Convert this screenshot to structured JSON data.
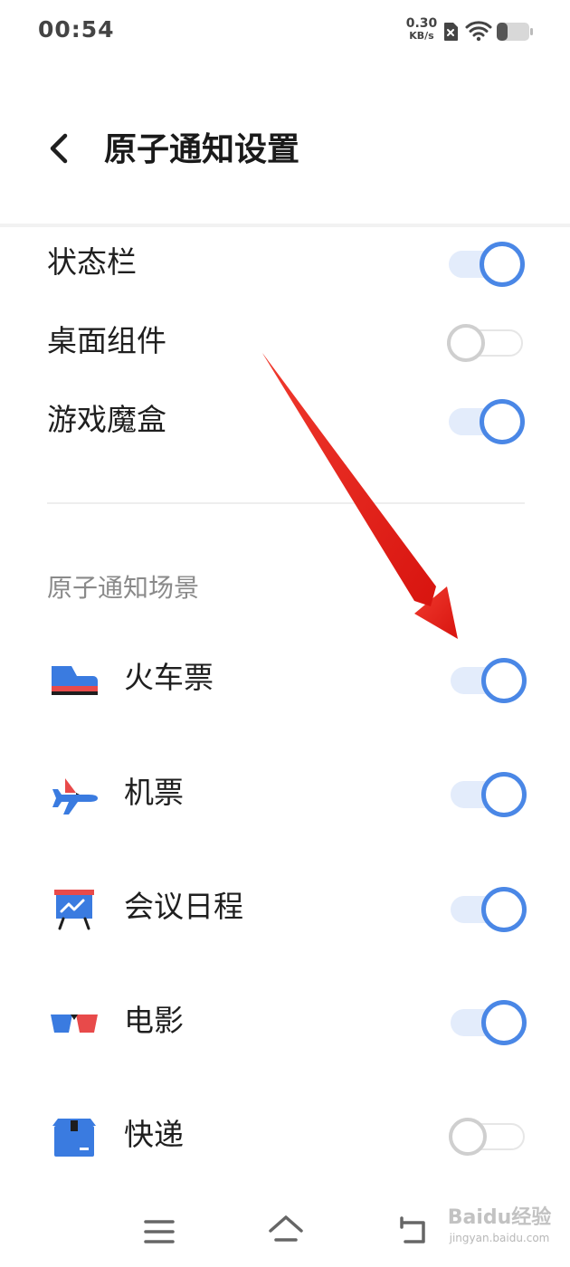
{
  "status_bar": {
    "time": "00:54",
    "net_speed_value": "0.30",
    "net_speed_unit": "KB/s",
    "icons": [
      "sim-disabled-icon",
      "wifi-icon",
      "battery-icon"
    ]
  },
  "header": {
    "back_icon": "chevron-left-icon",
    "title": "原子通知设置"
  },
  "display_locations": [
    {
      "label": "状态栏",
      "enabled": true
    },
    {
      "label": "桌面组件",
      "enabled": false
    },
    {
      "label": "游戏魔盒",
      "enabled": true
    }
  ],
  "scenes_section": {
    "title": "原子通知场景",
    "items": [
      {
        "label": "火车票",
        "icon": "train-icon",
        "enabled": true
      },
      {
        "label": "机票",
        "icon": "airplane-icon",
        "enabled": true
      },
      {
        "label": "会议日程",
        "icon": "presentation-board-icon",
        "enabled": true
      },
      {
        "label": "电影",
        "icon": "3d-glasses-icon",
        "enabled": true
      },
      {
        "label": "快递",
        "icon": "package-box-icon",
        "enabled": false
      }
    ]
  },
  "nav_bar": {
    "icons": [
      "menu-icon",
      "home-icon",
      "back-icon"
    ]
  },
  "watermark": {
    "main": "Baidu经验",
    "sub": "jingyan.baidu.com"
  },
  "colors": {
    "toggle_on": "#4a87e6",
    "toggle_on_track": "#e3ecfb",
    "toggle_off": "#cfcfcf",
    "annotation_arrow": "#e0201c"
  }
}
